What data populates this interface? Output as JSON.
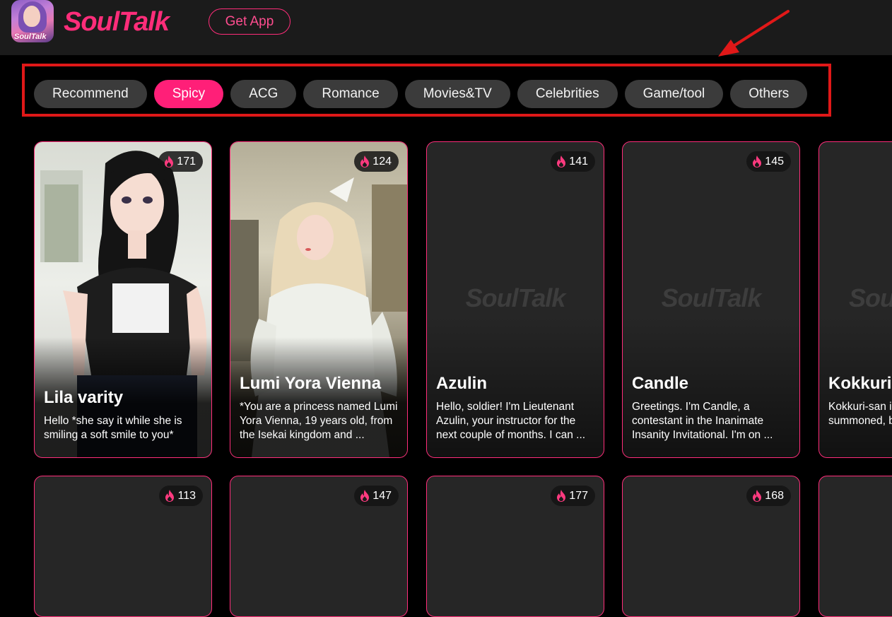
{
  "header": {
    "logo_icon_caption": "SoulTalk",
    "logo_text": "SoulTalk",
    "get_app_label": "Get App"
  },
  "tabs": [
    {
      "label": "Recommend",
      "active": false
    },
    {
      "label": "Spicy",
      "active": true
    },
    {
      "label": "ACG",
      "active": false
    },
    {
      "label": "Romance",
      "active": false
    },
    {
      "label": "Movies&TV",
      "active": false
    },
    {
      "label": "Celebrities",
      "active": false
    },
    {
      "label": "Game/tool",
      "active": false
    },
    {
      "label": "Others",
      "active": false
    }
  ],
  "watermark_text": "SoulTalk",
  "cards_row1": [
    {
      "name": "Lila varity",
      "count": "171",
      "desc": "Hello  *she say it while she is smiling a soft smile to you*",
      "image": "anime-girl-portrait"
    },
    {
      "name": "Lumi Yora Vienna",
      "count": "124",
      "desc": "*You are a princess named Lumi Yora Vienna, 19 years old, from the Isekai kingdom and ...",
      "image": "blonde-princess-photo"
    },
    {
      "name": "Azulin",
      "count": "141",
      "desc": "Hello, soldier! I'm Lieutenant Azulin, your instructor for the next couple of months. I can ...",
      "image": "placeholder"
    },
    {
      "name": "Candle",
      "count": "145",
      "desc": "Greetings. I'm Candle, a contestant in the Inanimate Insanity Invitational. I'm on ...",
      "image": "placeholder"
    },
    {
      "name": "Kokkuri-",
      "count": "",
      "desc": "Kokkuri-san is summoned, was summoned, began to haunt",
      "image": "placeholder"
    }
  ],
  "cards_row2": [
    {
      "count": "113"
    },
    {
      "count": "147"
    },
    {
      "count": "177"
    },
    {
      "count": "168"
    },
    {
      "count": ""
    }
  ],
  "colors": {
    "accent": "#ff2d7a",
    "active_tab": "#ff1f78",
    "annotation_red": "#e01818",
    "card_bg": "#262626",
    "page_bg": "#000000",
    "header_bg": "#1b1b1b"
  },
  "icons": {
    "badge": "flame-icon",
    "annotation": "red-arrow"
  }
}
